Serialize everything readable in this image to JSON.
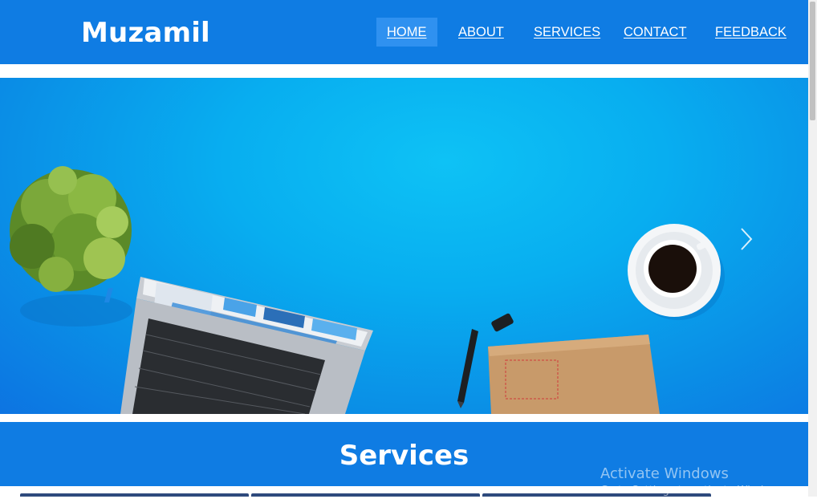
{
  "header": {
    "brand": "Muzamil",
    "nav": [
      {
        "label": "HOME",
        "active": true
      },
      {
        "label": "ABOUT"
      },
      {
        "label": "SERVICES"
      },
      {
        "label": "CONTACT"
      },
      {
        "label": "FEEDBACK"
      }
    ]
  },
  "hero": {
    "next_icon": "chevron-right-icon"
  },
  "services": {
    "title": "Services"
  },
  "watermark": {
    "title": "Activate Windows",
    "subtitle": "Go to Settings to activate Windows."
  },
  "colors": {
    "brand_blue": "#0f7ce3",
    "active_nav": "#2f91f0",
    "hero_light": "#0ec2f5"
  }
}
